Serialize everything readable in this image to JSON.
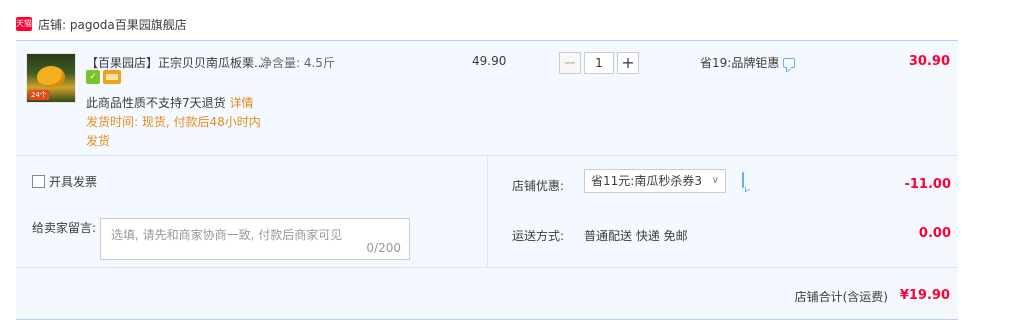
{
  "shop": {
    "badge": "天猫",
    "name_label": "店铺: pagoda百果园旗舰店"
  },
  "item": {
    "thumb_text": "",
    "thumb_price": "24个",
    "title": "【百果园店】正宗贝贝南瓜板栗...",
    "sku": "净含量: 4.5斤",
    "no_return": "此商品性质不支持7天退货",
    "detail_link": "详情",
    "delivery": "发货时间: 现货, 付款后48小时内发货",
    "price": "49.90",
    "quantity": "1",
    "minus": "−",
    "plus": "+",
    "discount": "省19:品牌钜惠",
    "subtotal": "30.90"
  },
  "invoice": {
    "label": "开具发票"
  },
  "message": {
    "label": "给卖家留言:",
    "placeholder": "选填, 请先和商家协商一致, 付款后商家可见",
    "count": "0/200"
  },
  "coupon": {
    "label": "店铺优惠:",
    "selected": "省11元:南瓜秒杀券3",
    "amount": "-11.00"
  },
  "shipping": {
    "label": "运送方式:",
    "value": "普通配送 快递 免邮",
    "amount": "0.00"
  },
  "total": {
    "label": "店铺合计(含运费)",
    "amount": "¥19.90"
  },
  "colors": {
    "price_red": "#ff0036",
    "link_orange": "#e48e1e",
    "panel_bg": "#f4f8ff"
  }
}
